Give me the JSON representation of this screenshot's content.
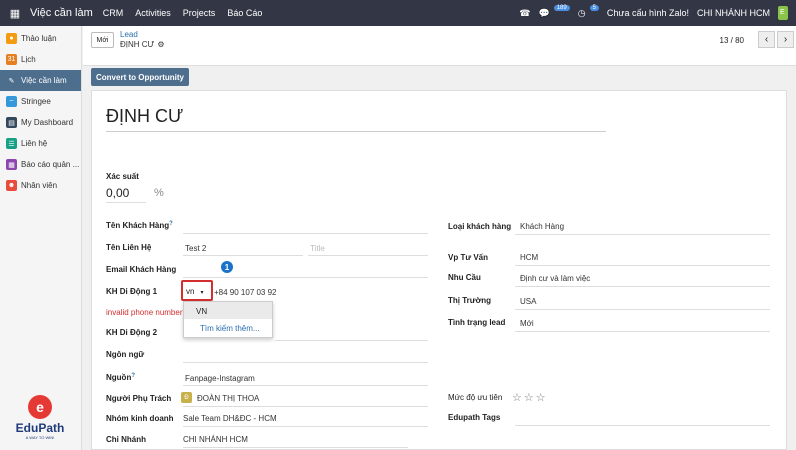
{
  "topbar": {
    "app": "Việc cần làm",
    "menus": [
      "CRM",
      "Activities",
      "Projects",
      "Báo Cáo"
    ],
    "msg_count": "189",
    "act_count": "5",
    "zalo": "Chưa cấu hình Zalo!",
    "company": "CHI NHÁNH HCM",
    "user_initial": "E"
  },
  "sidebar": {
    "items": [
      {
        "label": "Thảo luận",
        "color": "#f39c12"
      },
      {
        "label": "Lịch",
        "color": "#e67e22"
      },
      {
        "label": "Việc cần làm",
        "color": "#4e6e8e"
      },
      {
        "label": "Stringee",
        "color": "#3498db"
      },
      {
        "label": "My Dashboard",
        "color": "#34495e"
      },
      {
        "label": "Liên hệ",
        "color": "#16a085"
      },
      {
        "label": "Báo cáo quản ...",
        "color": "#8e44ad"
      },
      {
        "label": "Nhân viên",
        "color": "#e74c3c"
      }
    ],
    "logo_name": "EduPath",
    "logo_tag": "A WAY TO WIN!"
  },
  "control": {
    "new_label": "Mới",
    "breadcrumb_parent": "Lead",
    "breadcrumb_current": "ĐỊNH CƯ",
    "pager": "13 / 80"
  },
  "convert_label": "Convert to Opportunity",
  "form": {
    "title": "ĐỊNH CƯ",
    "probability_label": "Xác suất",
    "probability_value": "0,00",
    "percent": "%",
    "customer_name_label": "Tên Khách Hàng",
    "contact_label": "Tên Liên Hệ",
    "contact_value": "Test 2",
    "contact_title_placeholder": "Title",
    "email_label": "Email Khách Hàng",
    "mobile1_label": "KH Di Động 1",
    "country_value": "vn",
    "phone_value": "+84 90 107 03 92",
    "invalid_text": "invalid phone number",
    "mobile2_label": "KH Di Động 2",
    "language_label": "Ngôn ngữ",
    "source_label": "Nguồn",
    "source_value": "Fanpage-Instagram",
    "responsible_label": "Người Phụ Trách",
    "responsible_initial": "Đ",
    "responsible_value": "ĐOÀN THỊ THOA",
    "team_label": "Nhóm kinh doanh",
    "team_value": "Sale Team DH&ĐC - HCM",
    "branch_label": "Chi Nhánh",
    "branch_value": "CHI NHÁNH HCM",
    "customer_type_label": "Loại khách hàng",
    "customer_type_value": "Khách Hàng",
    "advisor_label": "Vp Tư Vấn",
    "advisor_value": "HCM",
    "need_label": "Nhu Cầu",
    "need_value": "Định cư và làm việc",
    "market_label": "Thị Trường",
    "market_value": "USA",
    "status_label": "Tình trạng lead",
    "status_value": "Mới",
    "priority_label": "Mức độ ưu tiên",
    "stars": "☆☆☆",
    "tags_label": "Edupath Tags",
    "marker": "1",
    "dropdown_options": [
      "VN",
      "Tìm kiếm thêm..."
    ]
  }
}
